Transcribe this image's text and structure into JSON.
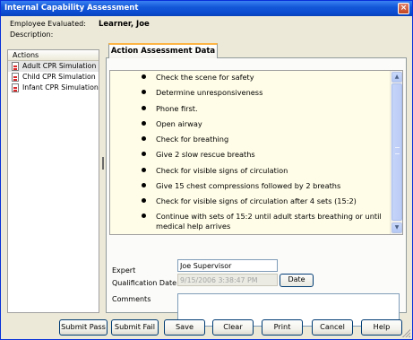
{
  "window": {
    "title": "Internal Capability Assessment",
    "close_icon": "close-icon",
    "close_glyph": "×"
  },
  "employee": {
    "label": "Employee Evaluated:",
    "value": "Learner, Joe",
    "description_label": "Description:"
  },
  "actions": {
    "header": "Actions",
    "items": [
      {
        "label": "Adult CPR Simulation",
        "icon": "document-icon",
        "selected": true
      },
      {
        "label": "Child CPR Simulation",
        "icon": "document-icon",
        "selected": false
      },
      {
        "label": "Infant CPR Simulation",
        "icon": "document-icon",
        "selected": false
      }
    ]
  },
  "tab": {
    "label": "Action Assessment Data"
  },
  "steps": [
    "Check the scene for safety",
    "Determine unresponsiveness",
    "Phone first.",
    "Open airway",
    "Check for breathing",
    "Give 2 slow rescue breaths",
    "Check for visible signs of circulation",
    "Give 15 chest compressions followed by 2 breaths",
    "Check for visible signs of circulation after 4 sets (15:2)",
    "Continue with sets of 15:2 until adult starts breathing or until medical help arrives"
  ],
  "scrollbar": {
    "up_glyph": "▲",
    "down_glyph": "▼"
  },
  "form": {
    "expert_label": "Expert",
    "expert_value": "Joe Supervisor",
    "qualification_label": "Qualification Date",
    "qualification_value": "9/15/2006 3:38:47 PM",
    "date_button": "Date",
    "comments_label": "Comments",
    "comments_value": ""
  },
  "buttons": {
    "submit_pass": "Submit Pass",
    "submit_fail": "Submit Fail",
    "save": "Save",
    "clear": "Clear",
    "print": "Print",
    "cancel": "Cancel",
    "help": "Help"
  },
  "colors": {
    "titlebar": "#0a4bd0",
    "dialog_background": "#ece9d8",
    "list_background": "#fffde7",
    "tab_highlight": "#fcb444"
  }
}
